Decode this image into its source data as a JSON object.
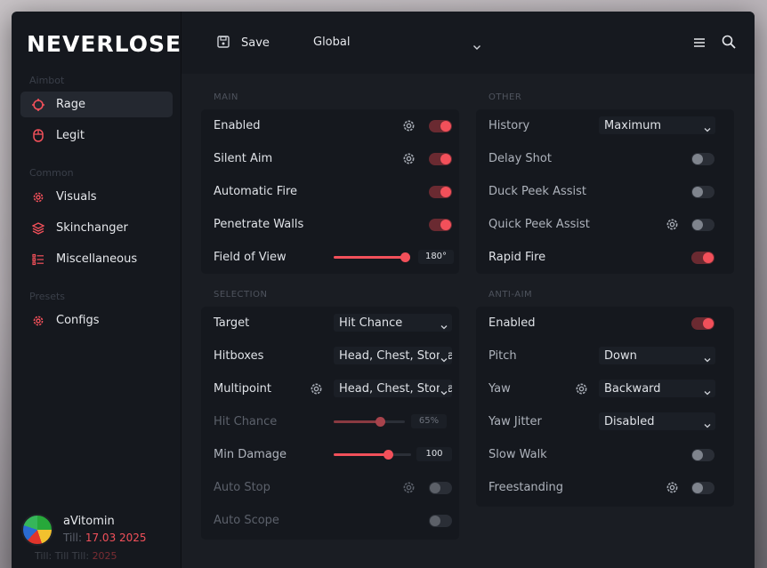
{
  "app": {
    "logo": "NEVERLOSE"
  },
  "sidebar": {
    "sections": [
      {
        "label": "Aimbot",
        "items": [
          {
            "label": "Rage",
            "icon": "crosshair-icon",
            "active": true
          },
          {
            "label": "Legit",
            "icon": "mouse-icon",
            "active": false
          }
        ]
      },
      {
        "label": "Common",
        "items": [
          {
            "label": "Visuals",
            "icon": "gear-icon",
            "active": false
          },
          {
            "label": "Skinchanger",
            "icon": "layers-icon",
            "active": false
          },
          {
            "label": "Miscellaneous",
            "icon": "list-icon",
            "active": false
          }
        ]
      },
      {
        "label": "Presets",
        "items": [
          {
            "label": "Configs",
            "icon": "gear-icon",
            "active": false
          }
        ]
      }
    ],
    "user": {
      "name": "aVitomin",
      "till_label": "Till:",
      "till_date": "17.03 2025",
      "ghost_label": "Till: Till Till:",
      "ghost_date": "2025"
    }
  },
  "topbar": {
    "save_label": "Save",
    "profile": "Global"
  },
  "groups": {
    "main": {
      "title": "MAIN",
      "rows": {
        "enabled": {
          "label": "Enabled",
          "value": true
        },
        "silent_aim": {
          "label": "Silent Aim",
          "value": true
        },
        "automatic_fire": {
          "label": "Automatic Fire",
          "value": true
        },
        "penetrate_walls": {
          "label": "Penetrate Walls",
          "value": true
        },
        "field_of_view": {
          "label": "Field of View",
          "value_text": "180°",
          "fraction": 1.0
        }
      }
    },
    "selection": {
      "title": "SELECTION",
      "rows": {
        "target": {
          "label": "Target",
          "value": "Hit Chance"
        },
        "hitboxes": {
          "label": "Hitboxes",
          "value": "Head, Chest, Stomach"
        },
        "multipoint": {
          "label": "Multipoint",
          "value": "Head, Chest, Stomach"
        },
        "hit_chance": {
          "label": "Hit Chance",
          "value_text": "65%",
          "fraction": 0.65
        },
        "min_damage": {
          "label": "Min Damage",
          "value_text": "100",
          "fraction": 0.7
        },
        "auto_stop": {
          "label": "Auto Stop",
          "value": false
        },
        "auto_scope": {
          "label": "Auto Scope",
          "value": false
        }
      }
    },
    "other": {
      "title": "OTHER",
      "rows": {
        "history": {
          "label": "History",
          "value": "Maximum"
        },
        "delay_shot": {
          "label": "Delay Shot",
          "value": false
        },
        "duck_peek": {
          "label": "Duck Peek Assist",
          "value": false
        },
        "quick_peek": {
          "label": "Quick Peek Assist",
          "value": false
        },
        "rapid_fire": {
          "label": "Rapid Fire",
          "value": true
        }
      }
    },
    "anti_aim": {
      "title": "ANTI-AIM",
      "rows": {
        "enabled": {
          "label": "Enabled",
          "value": true
        },
        "pitch": {
          "label": "Pitch",
          "value": "Down"
        },
        "yaw": {
          "label": "Yaw",
          "value": "Backward"
        },
        "yaw_jitter": {
          "label": "Yaw Jitter",
          "value": "Disabled"
        },
        "slow_walk": {
          "label": "Slow Walk",
          "value": false
        },
        "freestanding": {
          "label": "Freestanding",
          "value": false
        }
      }
    }
  },
  "colors": {
    "accent": "#f2505a",
    "sidebar": "#15181e",
    "main": "#1a1d23",
    "panel": "#15181e"
  }
}
